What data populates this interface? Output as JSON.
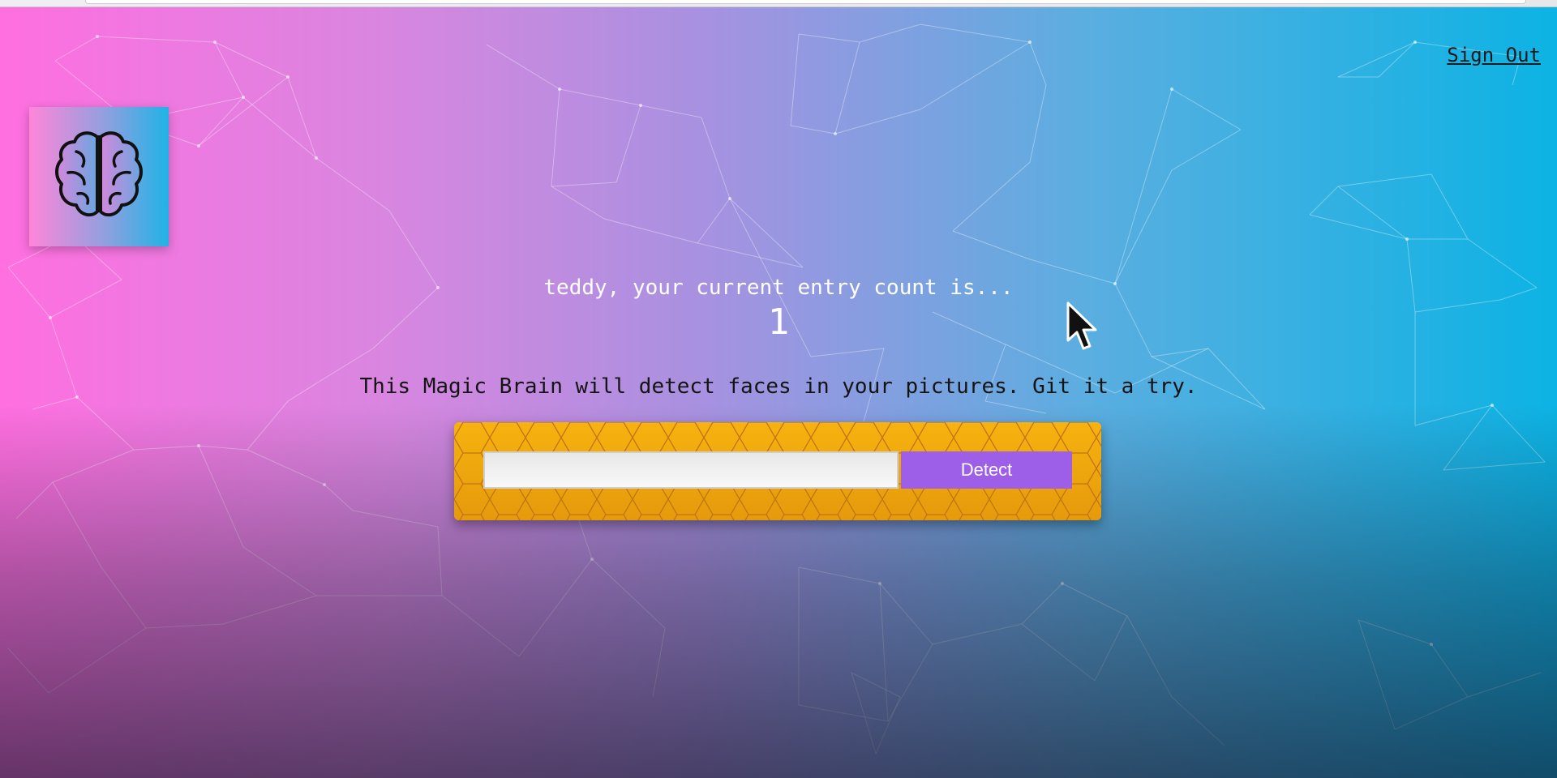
{
  "header": {
    "signout_label": "Sign Out",
    "logo_icon": "brain-icon"
  },
  "rank": {
    "prefix_text": "teddy, your current entry count is...",
    "count": "1"
  },
  "tagline": "This Magic Brain will detect faces in your pictures. Git it a try.",
  "form": {
    "input_value": "",
    "input_placeholder": "",
    "button_label": "Detect"
  },
  "colors": {
    "gradient_left": "#ff6fe0",
    "gradient_right": "#0cb3e4",
    "panel_orange": "#f3a90d",
    "button_purple": "#9d5ee8"
  }
}
